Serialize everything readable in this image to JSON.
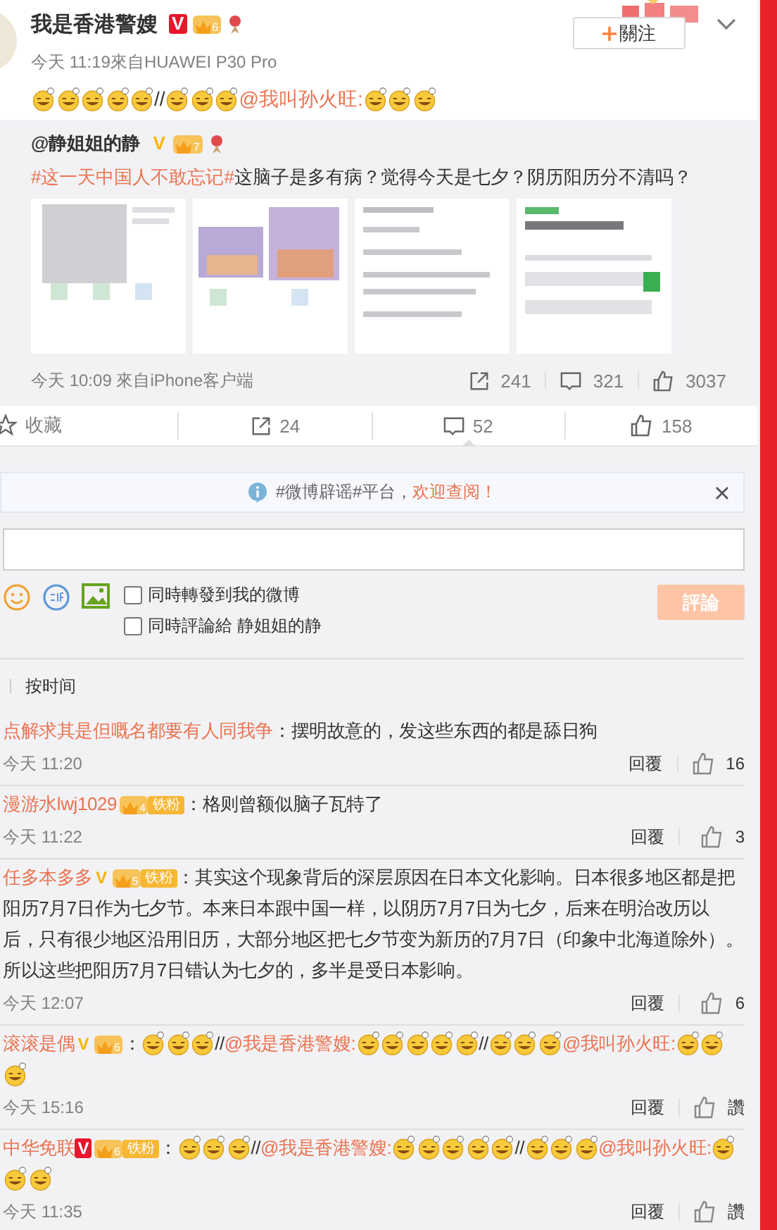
{
  "post": {
    "author": "我是香港警嫂",
    "verified": {
      "kind": "official",
      "mark": "V"
    },
    "level": "6",
    "medal": true,
    "time": "今天 11:19來自HUAWEI P30 Pro",
    "follow": "關注",
    "content": [
      {
        "kind": "emoji"
      },
      {
        "kind": "emoji"
      },
      {
        "kind": "emoji"
      },
      {
        "kind": "emoji"
      },
      {
        "kind": "emoji"
      },
      {
        "kind": "text",
        "text": "//"
      },
      {
        "kind": "emoji"
      },
      {
        "kind": "emoji"
      },
      {
        "kind": "emoji"
      },
      {
        "kind": "mention",
        "text": "@我叫孙火旺:"
      },
      {
        "kind": "emoji"
      },
      {
        "kind": "emoji"
      },
      {
        "kind": "emoji"
      }
    ]
  },
  "retweet": {
    "author": "@静姐姐的静",
    "verified": {
      "kind": "personal",
      "mark": "V"
    },
    "level": "7",
    "medal": true,
    "content": [
      {
        "kind": "topic",
        "text": "#这一天中国人不敢忘记#"
      },
      {
        "kind": "text",
        "text": "这脑子是多有病？觉得今天是七夕？阴历阳历分不清吗？"
      }
    ],
    "time": "今天 10:09 來自iPhone客户端",
    "reposts": "241",
    "comments": "321",
    "likes": "3037"
  },
  "actions": [
    {
      "kind": "favorite",
      "label": "收藏",
      "selected": false
    },
    {
      "kind": "repost",
      "label": "24",
      "selected": false
    },
    {
      "kind": "comment",
      "label": "52",
      "selected": true
    },
    {
      "kind": "like",
      "label": "158",
      "selected": false
    }
  ],
  "notice": {
    "text": "#微博辟谣#平台，",
    "link": "欢迎查阅！"
  },
  "composer": {
    "options": [
      {
        "label": "同時轉發到我的微博",
        "checked": false
      },
      {
        "label": "同時評論給 静姐姐的静",
        "checked": false
      }
    ],
    "submit": "評論",
    "submit_disabled": true
  },
  "sort": "按时间",
  "comments": [
    {
      "author": "点解求其是但嘅名都要有人同我争",
      "separator": "：",
      "content": [
        {
          "kind": "text",
          "text": "摆明故意的，发这些东西的都是舔日狗"
        }
      ],
      "time": "今天 11:20",
      "reply": "回覆",
      "likes": "16"
    },
    {
      "author": "漫游水lwj1029",
      "level": "4",
      "fan_badge": "铁粉",
      "separator": "：",
      "content": [
        {
          "kind": "text",
          "text": "格则曾额似脑子瓦特了"
        }
      ],
      "time": "今天 11:22",
      "reply": "回覆",
      "likes": "3"
    },
    {
      "author": "任多本多多",
      "verified": {
        "kind": "personal",
        "mark": "V"
      },
      "level": "5",
      "fan_badge": "铁粉",
      "separator": "：",
      "content": [
        {
          "kind": "text",
          "text": "其实这个现象背后的深层原因在日本文化影响。日本很多地区都是把阳历7月7日作为七夕节。本来日本跟中国一样，以阴历7月7日为七夕，后来在明治改历以后，只有很少地区沿用旧历，大部分地区把七夕节变为新历的7月7日（印象中北海道除外）。所以这些把阳历7月7日错认为七夕的，多半是受日本影响。"
        }
      ],
      "time": "今天 12:07",
      "reply": "回覆",
      "likes": "6"
    },
    {
      "author": "滚滚是偶",
      "verified": {
        "kind": "personal",
        "mark": "V"
      },
      "level": "6",
      "separator": "：",
      "content": [
        {
          "kind": "emoji"
        },
        {
          "kind": "emoji"
        },
        {
          "kind": "emoji"
        },
        {
          "kind": "text",
          "text": "//"
        },
        {
          "kind": "mention",
          "text": "@我是香港警嫂:"
        },
        {
          "kind": "emoji"
        },
        {
          "kind": "emoji"
        },
        {
          "kind": "emoji"
        },
        {
          "kind": "emoji"
        },
        {
          "kind": "emoji"
        },
        {
          "kind": "text",
          "text": "//"
        },
        {
          "kind": "emoji"
        },
        {
          "kind": "emoji"
        },
        {
          "kind": "emoji"
        },
        {
          "kind": "mention",
          "text": "@我叫孙火旺:"
        },
        {
          "kind": "emoji"
        },
        {
          "kind": "emoji"
        },
        {
          "kind": "emoji"
        }
      ],
      "time": "今天 15:16",
      "reply": "回覆",
      "likes": "讚"
    },
    {
      "author": "中华免联",
      "verified": {
        "kind": "official",
        "mark": "V"
      },
      "level": "6",
      "fan_badge": "铁粉",
      "separator": "：",
      "content": [
        {
          "kind": "emoji"
        },
        {
          "kind": "emoji"
        },
        {
          "kind": "emoji"
        },
        {
          "kind": "text",
          "text": "//"
        },
        {
          "kind": "mention",
          "text": "@我是香港警嫂:"
        },
        {
          "kind": "emoji"
        },
        {
          "kind": "emoji"
        },
        {
          "kind": "emoji"
        },
        {
          "kind": "emoji"
        },
        {
          "kind": "emoji"
        },
        {
          "kind": "text",
          "text": "//"
        },
        {
          "kind": "emoji"
        },
        {
          "kind": "emoji"
        },
        {
          "kind": "emoji"
        },
        {
          "kind": "mention",
          "text": "@我叫孙火旺:"
        },
        {
          "kind": "emoji"
        },
        {
          "kind": "emoji"
        },
        {
          "kind": "emoji"
        }
      ],
      "time": "今天 11:35",
      "reply": "回覆",
      "likes": "讚"
    }
  ]
}
